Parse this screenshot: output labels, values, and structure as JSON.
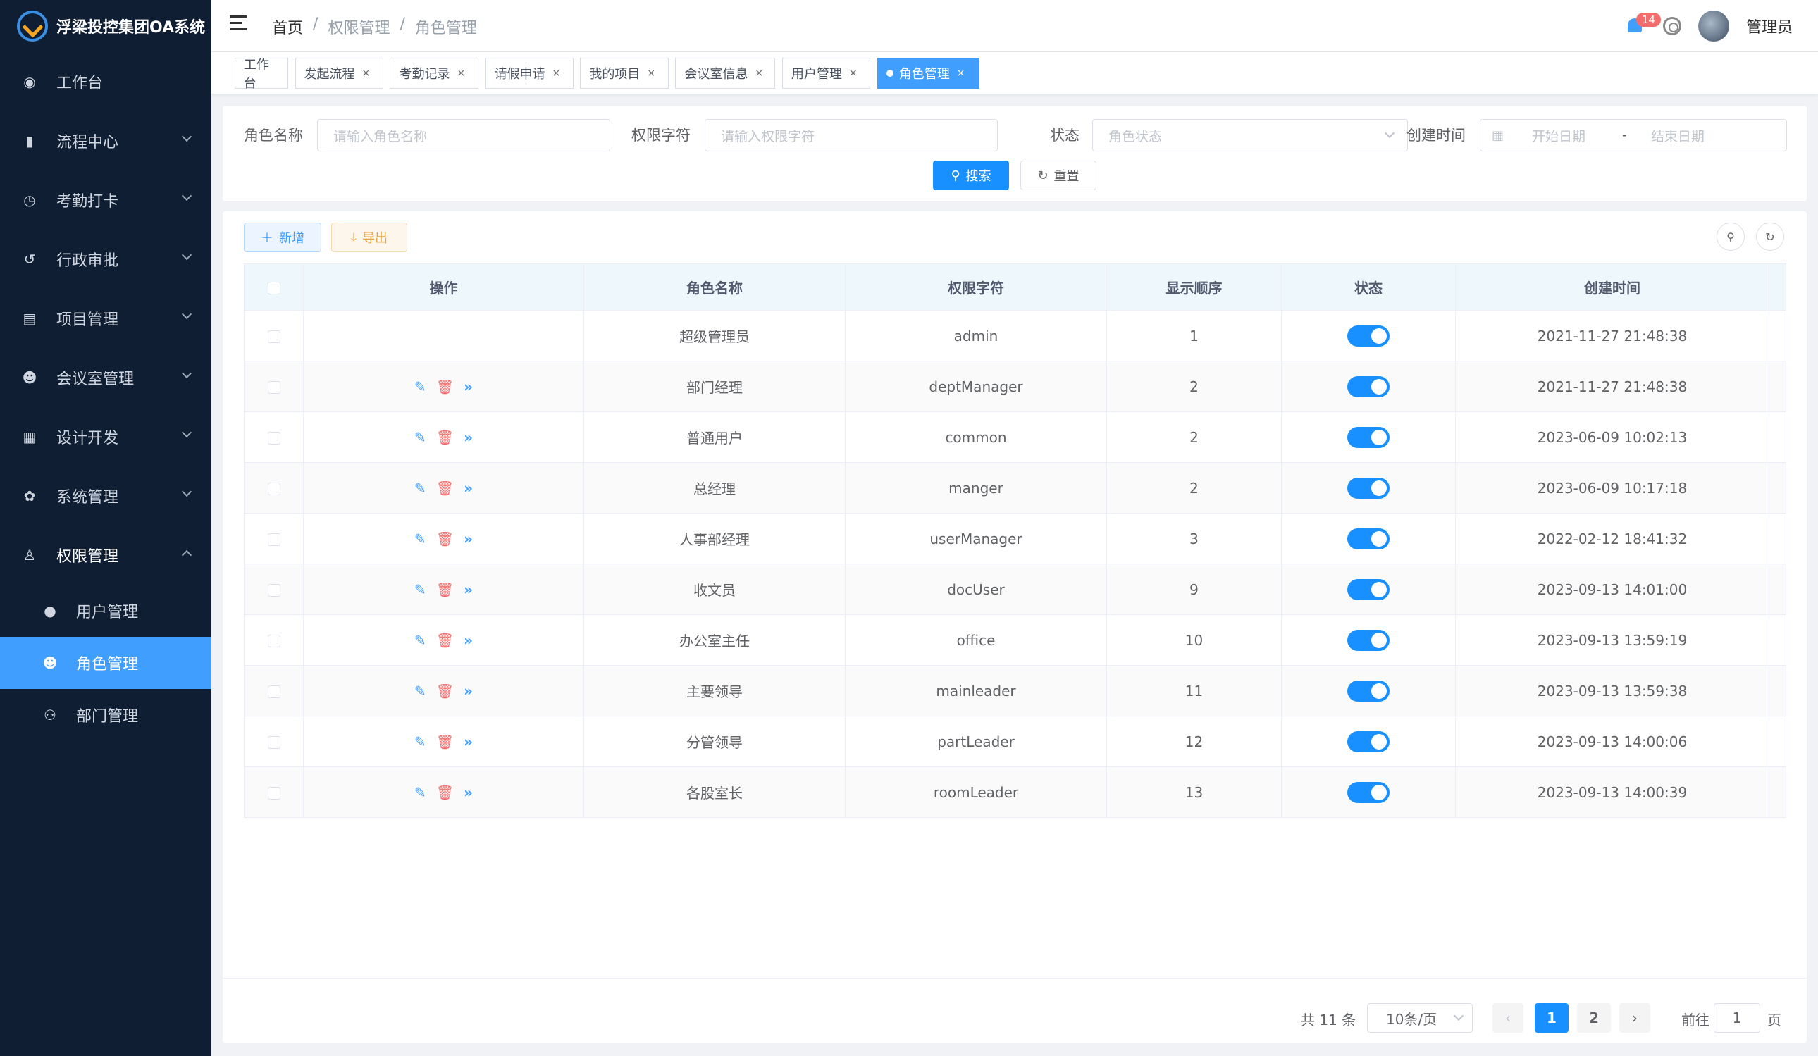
{
  "app": {
    "title": "浮梁投控集团OA系统"
  },
  "sidebar": {
    "items": [
      {
        "label": "工作台",
        "icon": "dashboard-icon",
        "glyph": "◉"
      },
      {
        "label": "流程中心",
        "icon": "bar-chart-icon",
        "glyph": "▮"
      },
      {
        "label": "考勤打卡",
        "icon": "clock-icon",
        "glyph": "◷"
      },
      {
        "label": "行政审批",
        "icon": "history-icon",
        "glyph": "↺"
      },
      {
        "label": "项目管理",
        "icon": "document-icon",
        "glyph": "▤"
      },
      {
        "label": "会议室管理",
        "icon": "people-icon",
        "glyph": "☻"
      },
      {
        "label": "设计开发",
        "icon": "form-icon",
        "glyph": "▦"
      },
      {
        "label": "系统管理",
        "icon": "gear-icon",
        "glyph": "✿"
      },
      {
        "label": "权限管理",
        "icon": "user-icon",
        "glyph": "♙"
      }
    ],
    "subitems": [
      {
        "label": "用户管理",
        "icon": "user-icon",
        "glyph": "●"
      },
      {
        "label": "角色管理",
        "icon": "peoples-icon",
        "glyph": "☻"
      },
      {
        "label": "部门管理",
        "icon": "tree-icon",
        "glyph": "⚇"
      }
    ]
  },
  "header": {
    "breadcrumb": [
      "首页",
      "权限管理",
      "角色管理"
    ],
    "notification_count": "14",
    "user_name": "管理员"
  },
  "tags": [
    {
      "label": "工作台",
      "closable": false
    },
    {
      "label": "发起流程",
      "closable": true
    },
    {
      "label": "考勤记录",
      "closable": true
    },
    {
      "label": "请假申请",
      "closable": true
    },
    {
      "label": "我的项目",
      "closable": true
    },
    {
      "label": "会议室信息",
      "closable": true
    },
    {
      "label": "用户管理",
      "closable": true
    },
    {
      "label": "角色管理",
      "closable": true,
      "active": true
    }
  ],
  "search": {
    "role_name_label": "角色名称",
    "role_name_placeholder": "请输入角色名称",
    "perm_label": "权限字符",
    "perm_placeholder": "请输入权限字符",
    "status_label": "状态",
    "status_placeholder": "角色状态",
    "created_label": "创建时间",
    "start_placeholder": "开始日期",
    "range_sep": "-",
    "end_placeholder": "结束日期",
    "search_btn": "搜索",
    "reset_btn": "重置"
  },
  "toolbar": {
    "add_btn": "新增",
    "export_btn": "导出"
  },
  "table": {
    "columns": [
      "操作",
      "角色名称",
      "权限字符",
      "显示顺序",
      "状态",
      "创建时间"
    ],
    "rows": [
      {
        "name": "超级管理员",
        "key": "admin",
        "order": "1",
        "status": true,
        "created": "2021-11-27 21:48:38",
        "ops": false
      },
      {
        "name": "部门经理",
        "key": "deptManager",
        "order": "2",
        "status": true,
        "created": "2021-11-27 21:48:38",
        "ops": true
      },
      {
        "name": "普通用户",
        "key": "common",
        "order": "2",
        "status": true,
        "created": "2023-06-09 10:02:13",
        "ops": true
      },
      {
        "name": "总经理",
        "key": "manger",
        "order": "2",
        "status": true,
        "created": "2023-06-09 10:17:18",
        "ops": true
      },
      {
        "name": "人事部经理",
        "key": "userManager",
        "order": "3",
        "status": true,
        "created": "2022-02-12 18:41:32",
        "ops": true
      },
      {
        "name": "收文员",
        "key": "docUser",
        "order": "9",
        "status": true,
        "created": "2023-09-13 14:01:00",
        "ops": true
      },
      {
        "name": "办公室主任",
        "key": "office",
        "order": "10",
        "status": true,
        "created": "2023-09-13 13:59:19",
        "ops": true
      },
      {
        "name": "主要领导",
        "key": "mainleader",
        "order": "11",
        "status": true,
        "created": "2023-09-13 13:59:38",
        "ops": true
      },
      {
        "name": "分管领导",
        "key": "partLeader",
        "order": "12",
        "status": true,
        "created": "2023-09-13 14:00:06",
        "ops": true
      },
      {
        "name": "各股室长",
        "key": "roomLeader",
        "order": "13",
        "status": true,
        "created": "2023-09-13 14:00:39",
        "ops": true
      }
    ]
  },
  "pagination": {
    "total_text": "共 11 条",
    "page_size": "10条/页",
    "pages": [
      "1",
      "2"
    ],
    "current": "1",
    "goto_label": "前往",
    "goto_value": "1",
    "page_unit": "页"
  },
  "colors": {
    "primary": "#1890ff",
    "sidebar_bg": "#0f1e33",
    "danger": "#f56c6c",
    "warning": "#e6a23c"
  }
}
